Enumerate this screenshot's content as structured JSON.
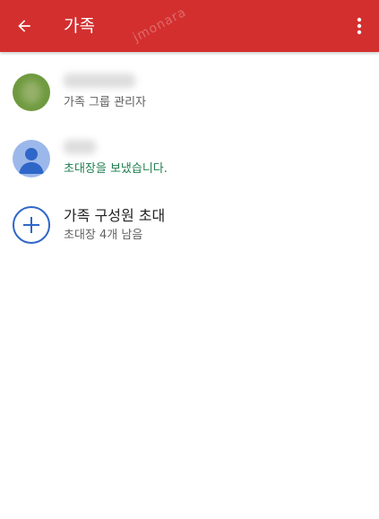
{
  "app_bar": {
    "title": "가족",
    "watermark": "jmonara",
    "back_icon": "arrow-back-icon",
    "more_icon": "more-vert-icon"
  },
  "members": [
    {
      "avatar": "photo-avatar",
      "role": "가족 그룹 관리자"
    },
    {
      "avatar": "person-icon",
      "status": "초대장을 보냈습니다."
    }
  ],
  "invite": {
    "icon": "add-circle-icon",
    "title": "가족 구성원 초대",
    "subtitle": "초대장 4개 남음"
  },
  "colors": {
    "app_bar": "#d32f2f",
    "invite_status": "#1e7e4f",
    "add_icon": "#2f67c9"
  }
}
